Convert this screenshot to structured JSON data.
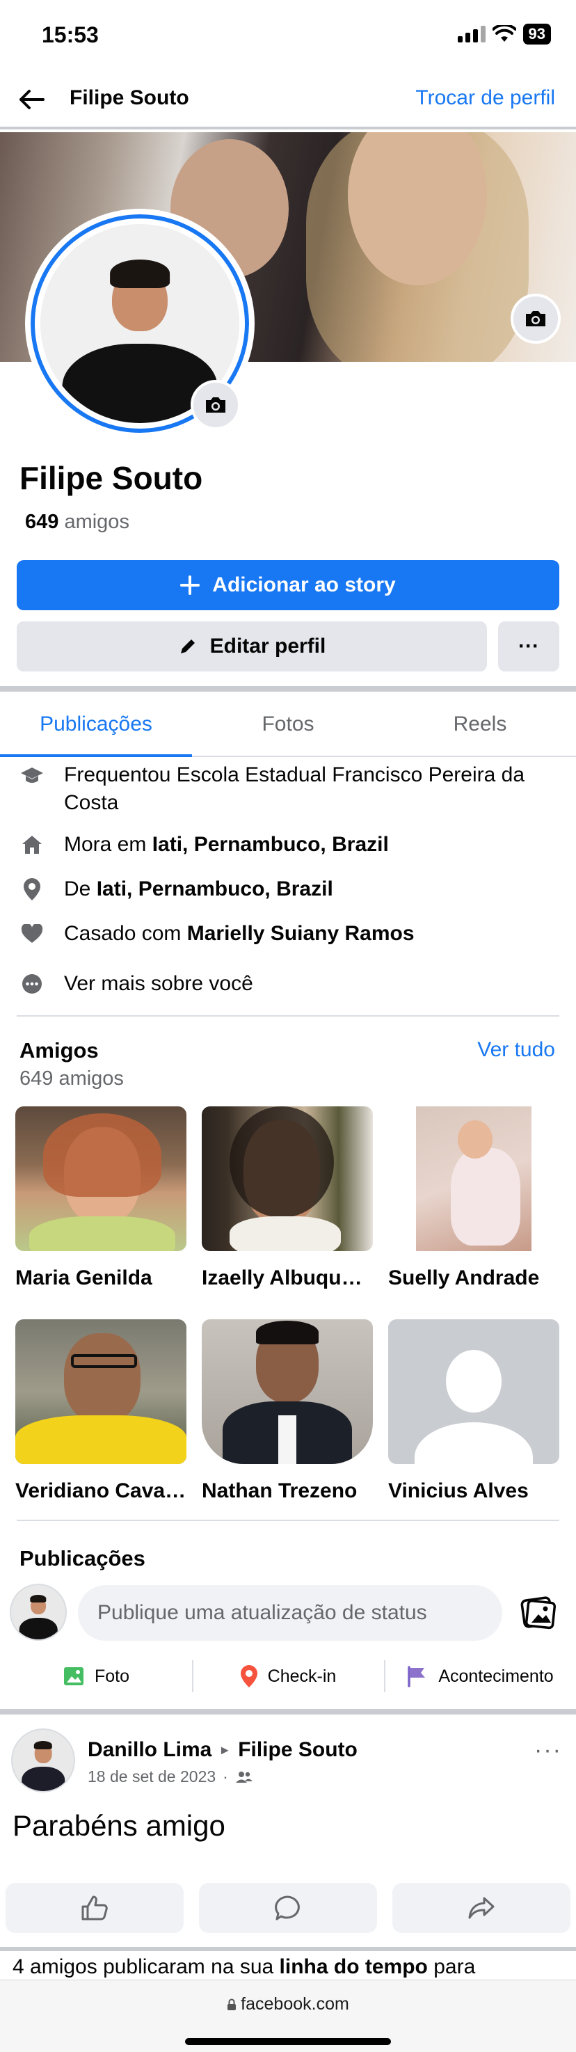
{
  "status_bar": {
    "time": "15:53",
    "battery": "93"
  },
  "header": {
    "title": "Filipe Souto",
    "switch_profile": "Trocar de perfil"
  },
  "profile": {
    "name": "Filipe Souto",
    "friends_count": "649",
    "friends_label": "amigos",
    "add_story": "Adicionar ao story",
    "edit_profile": "Editar perfil",
    "more": "···"
  },
  "tabs": [
    {
      "label": "Publicações",
      "active": true
    },
    {
      "label": "Fotos",
      "active": false
    },
    {
      "label": "Reels",
      "active": false
    }
  ],
  "details": {
    "studied": "Frequentou Escola Estadual Francisco Pereira da Costa",
    "lives_prefix": "Mora em ",
    "lives_place": "Iati, Pernambuco, Brazil",
    "from_prefix": "De ",
    "from_place": "Iati, Pernambuco, Brazil",
    "married_prefix": "Casado com ",
    "married_name": "Marielly Suiany Ramos",
    "see_more": "Ver mais sobre você"
  },
  "friends": {
    "title": "Amigos",
    "count_text": "649 amigos",
    "see_all": "Ver tudo",
    "items": [
      {
        "name": "Maria Genilda"
      },
      {
        "name": "Izaelly Albuquerque"
      },
      {
        "name": "Suelly Andrade"
      },
      {
        "name": "Veridiano Cavalcante"
      },
      {
        "name": "Nathan Trezeno"
      },
      {
        "name": "Vinicius Alves"
      }
    ]
  },
  "posts_section": {
    "title": "Publicações",
    "composer_placeholder": "Publique uma atualização de status",
    "actions": [
      "Foto",
      "Check-in",
      "Acontecimento"
    ]
  },
  "post": {
    "author": "Danillo Lima",
    "target": "Filipe Souto",
    "date": "18 de set de 2023",
    "separator": "·",
    "text": "Parabéns amigo"
  },
  "notice": {
    "prefix": "4 amigos publicaram na sua ",
    "bold": "linha do tempo",
    "suffix": " para"
  },
  "browser": {
    "url": "facebook.com"
  },
  "colors": {
    "accent": "#1877f2",
    "separator": "#c9ccd1",
    "muted_text": "#65676b"
  }
}
